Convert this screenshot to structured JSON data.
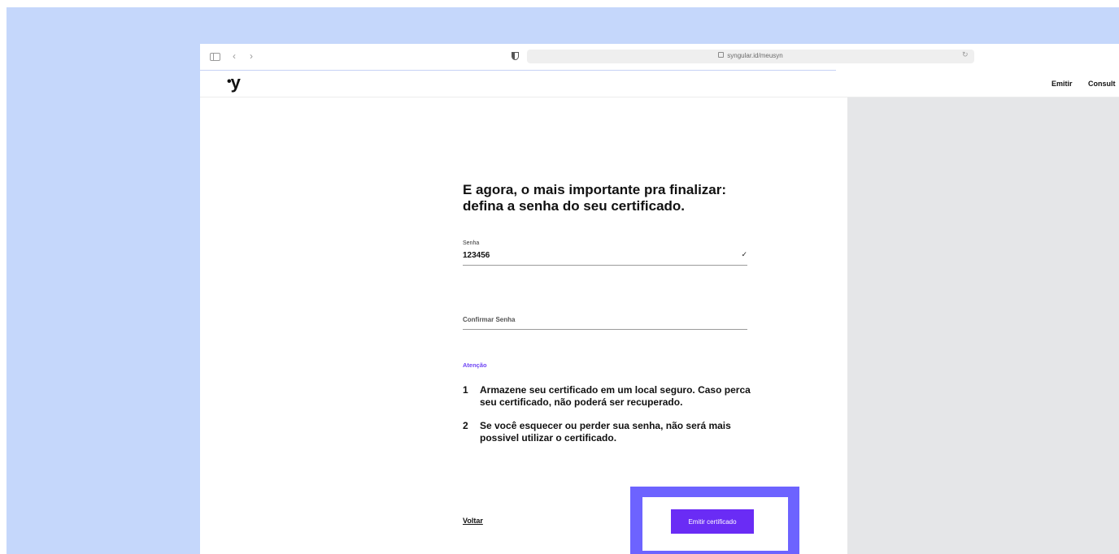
{
  "browser": {
    "url": "syngular.id/meusyn",
    "icons": [
      "sidebar-icon",
      "back-icon",
      "forward-icon",
      "shield-icon",
      "lock-icon",
      "reload-icon"
    ]
  },
  "header": {
    "logo": "y",
    "nav": [
      "Emitir",
      "Consult"
    ]
  },
  "main": {
    "title_line1": "E agora, o mais importante pra finalizar:",
    "title_line2": "defina a senha do seu certificado.",
    "senha_label": "Senha",
    "senha_value": "123456",
    "confirm_placeholder": "Confirmar Senha",
    "attention": "Atenção",
    "items": [
      {
        "num": "1",
        "text": "Armazene seu certificado em um local seguro.  Caso perca seu certificado, não poderá ser recuperado."
      },
      {
        "num": "2",
        "text": "Se você esquecer ou perder sua senha, não será mais possivel utilizar o certificado."
      }
    ],
    "back_label": "Voltar",
    "emit_label": "Emitir certificado"
  },
  "colors": {
    "accent": "#6a2cf5",
    "highlight": "#6d63ff",
    "backdrop": "#c5d7fb",
    "panel": "#e5e6e8"
  }
}
